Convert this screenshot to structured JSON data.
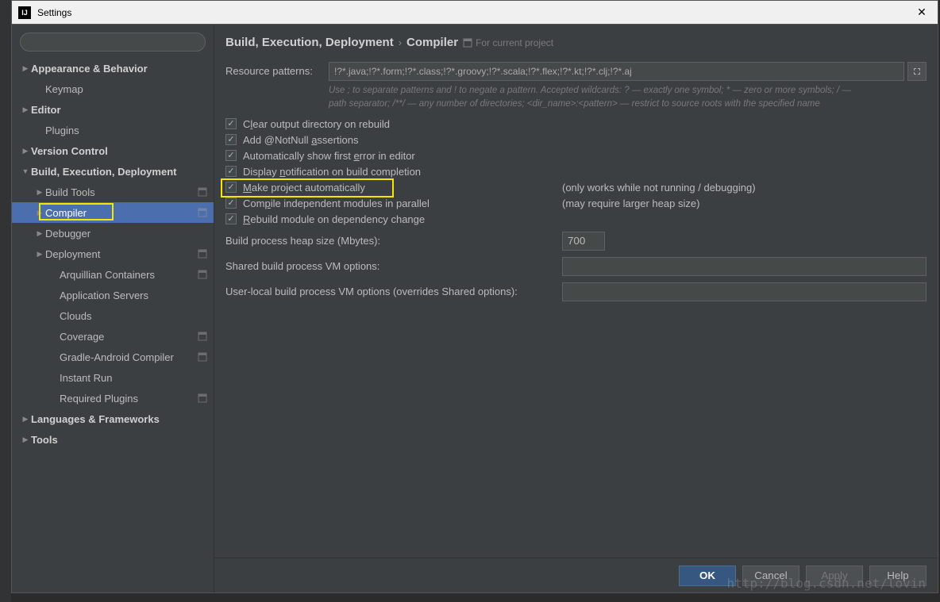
{
  "window": {
    "title": "Settings"
  },
  "breadcrumb": {
    "path1": "Build, Execution, Deployment",
    "path2": "Compiler",
    "note": "For current project"
  },
  "sidebar": {
    "items": [
      {
        "label": "Appearance & Behavior",
        "bold": true,
        "indent": 0,
        "arrow": "▶"
      },
      {
        "label": "Keymap",
        "indent": 1
      },
      {
        "label": "Editor",
        "bold": true,
        "indent": 0,
        "arrow": "▶"
      },
      {
        "label": "Plugins",
        "indent": 1
      },
      {
        "label": "Version Control",
        "bold": true,
        "indent": 0,
        "arrow": "▶"
      },
      {
        "label": "Build, Execution, Deployment",
        "bold": true,
        "indent": 0,
        "arrow": "▼"
      },
      {
        "label": "Build Tools",
        "indent": 1,
        "arrow": "▶",
        "proj": true
      },
      {
        "label": "Compiler",
        "indent": 1,
        "arrow": "▶",
        "proj": true,
        "selected": true,
        "highlight": true
      },
      {
        "label": "Debugger",
        "indent": 1,
        "arrow": "▶"
      },
      {
        "label": "Deployment",
        "indent": 1,
        "arrow": "▶",
        "proj": true
      },
      {
        "label": "Arquillian Containers",
        "indent": 2,
        "proj": true
      },
      {
        "label": "Application Servers",
        "indent": 2
      },
      {
        "label": "Clouds",
        "indent": 2
      },
      {
        "label": "Coverage",
        "indent": 2,
        "proj": true
      },
      {
        "label": "Gradle-Android Compiler",
        "indent": 2,
        "proj": true
      },
      {
        "label": "Instant Run",
        "indent": 2
      },
      {
        "label": "Required Plugins",
        "indent": 2,
        "proj": true
      },
      {
        "label": "Languages & Frameworks",
        "bold": true,
        "indent": 0,
        "arrow": "▶"
      },
      {
        "label": "Tools",
        "bold": true,
        "indent": 0,
        "arrow": "▶"
      }
    ]
  },
  "form": {
    "resource_label": "Resource patterns:",
    "resource_value": "!?*.java;!?*.form;!?*.class;!?*.groovy;!?*.scala;!?*.flex;!?*.kt;!?*.clj;!?*.aj",
    "hint_line1": "Use ; to separate patterns and ! to negate a pattern. Accepted wildcards: ? — exactly one symbol; * — zero or more symbols; / —",
    "hint_line2": "path separator; /**/ — any number of directories; <dir_name>:<pattern> — restrict to source roots with the specified name",
    "checks": [
      {
        "label": "Clear output directory on rebuild",
        "checked": true,
        "u": "l"
      },
      {
        "label": "Add @NotNull assertions",
        "checked": true,
        "u": "a"
      },
      {
        "label": "Automatically show first error in editor",
        "checked": true,
        "u": "e"
      },
      {
        "label": "Display notification on build completion",
        "checked": true,
        "u": "n"
      },
      {
        "label": "Make project automatically",
        "checked": true,
        "u": "M",
        "note": "(only works while not running / debugging)",
        "highlight": true
      },
      {
        "label": "Compile independent modules in parallel",
        "checked": true,
        "u": "p",
        "note": "(may require larger heap size)"
      },
      {
        "label": "Rebuild module on dependency change",
        "checked": true,
        "u": "R"
      }
    ],
    "heap_label": "Build process heap size (Mbytes):",
    "heap_value": "700",
    "shared_vm_label": "Shared build process VM options:",
    "shared_vm_value": "",
    "user_vm_label": "User-local build process VM options (overrides Shared options):",
    "user_vm_value": ""
  },
  "footer": {
    "ok": "OK",
    "cancel": "Cancel",
    "apply": "Apply",
    "help": "Help"
  },
  "watermark": "http://blog.csdn.net/lovin"
}
